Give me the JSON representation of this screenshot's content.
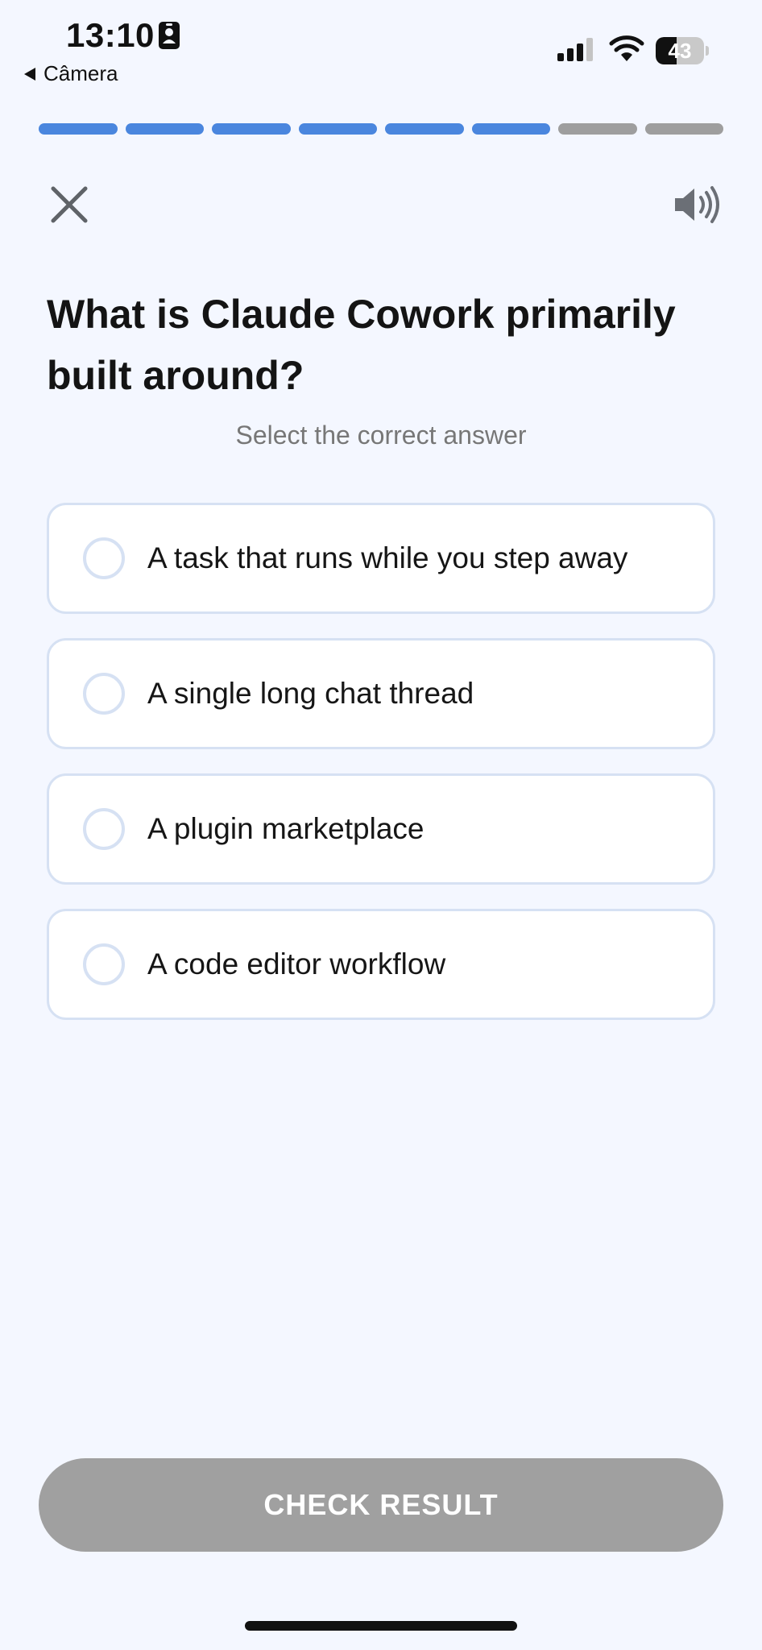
{
  "status_bar": {
    "time": "13:10",
    "back_app": "Câmera",
    "battery_level": "43",
    "battery_fraction": 0.43
  },
  "progress": {
    "total_steps": 8,
    "completed_steps": 6,
    "completed_color": "#4a86de",
    "remaining_color": "#9e9e9e"
  },
  "quiz": {
    "question": "What is Claude Cowork primarily built around?",
    "subtitle": "Select the correct answer",
    "options": [
      {
        "label": "A task that runs while you step away"
      },
      {
        "label": "A single long chat thread"
      },
      {
        "label": "A plugin marketplace"
      },
      {
        "label": "A code editor workflow"
      }
    ]
  },
  "actions": {
    "check_label": "CHECK RESULT"
  },
  "icons": {
    "close": "close-icon",
    "sound": "speaker-icon"
  },
  "colors": {
    "background": "#f4f7ff",
    "button_disabled": "#a0a0a0",
    "option_border": "#d6e1f3"
  }
}
